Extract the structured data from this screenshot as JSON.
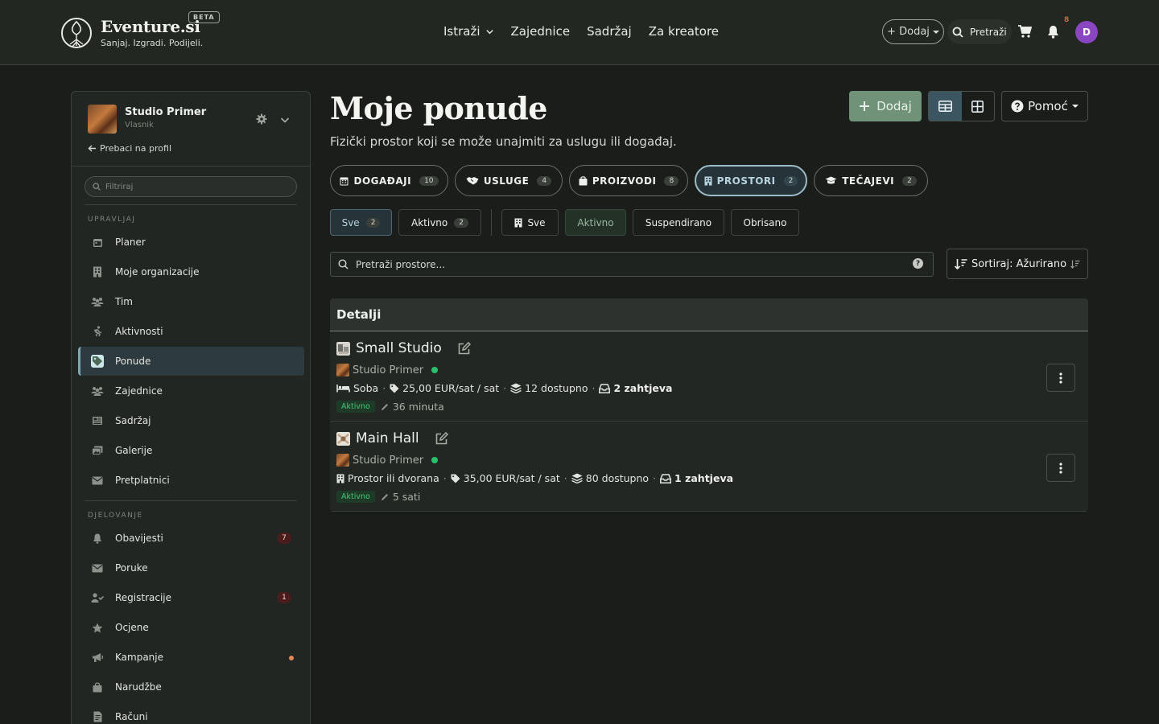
{
  "header": {
    "brand": "Eventure.si",
    "beta": "BETA",
    "tagline": "Sanjaj. Izgradi. Podijeli.",
    "nav": [
      "Istraži",
      "Zajednice",
      "Sadržaj",
      "Za kreatore"
    ],
    "add_label": "+ Dodaj",
    "search_label": "Pretraži",
    "notification_count": "8",
    "avatar_initial": "D"
  },
  "sidebar": {
    "org_name": "Studio Primer",
    "org_role": "Vlasnik",
    "switch_label": "Prebaci na profil",
    "filter_placeholder": "Filtriraj",
    "section_manage": "UPRAVLJAJ",
    "section_act": "DJELOVANJE",
    "manage_items": [
      {
        "label": "Planer",
        "icon": "calendar-icon"
      },
      {
        "label": "Moje organizacije",
        "icon": "building-icon"
      },
      {
        "label": "Tim",
        "icon": "team-icon"
      },
      {
        "label": "Aktivnosti",
        "icon": "running-icon"
      },
      {
        "label": "Ponude",
        "icon": "tag-icon"
      },
      {
        "label": "Zajednice",
        "icon": "community-icon"
      },
      {
        "label": "Sadržaj",
        "icon": "newspaper-icon"
      },
      {
        "label": "Galerije",
        "icon": "images-icon"
      },
      {
        "label": "Pretplatnici",
        "icon": "envelope-icon"
      }
    ],
    "act_items": [
      {
        "label": "Obavijesti",
        "icon": "bell-icon",
        "badge": "7"
      },
      {
        "label": "Poruke",
        "icon": "envelope-icon"
      },
      {
        "label": "Registracije",
        "icon": "user-check-icon",
        "badge": "1"
      },
      {
        "label": "Ocjene",
        "icon": "star-icon"
      },
      {
        "label": "Kampanje",
        "icon": "megaphone-icon"
      },
      {
        "label": "Narudžbe",
        "icon": "bag-icon"
      },
      {
        "label": "Računi",
        "icon": "invoice-icon"
      }
    ]
  },
  "main": {
    "title": "Moje ponude",
    "subtitle": "Fizički prostor koji se može unajmiti za uslugu ili događaj.",
    "add_label": "Dodaj",
    "help_label": "Pomoć",
    "types": [
      {
        "label": "DOGAĐAJI",
        "count": "10"
      },
      {
        "label": "USLUGE",
        "count": "4"
      },
      {
        "label": "PROIZVODI",
        "count": "8"
      },
      {
        "label": "PROSTORI",
        "count": "2"
      },
      {
        "label": "TEČAJEVI",
        "count": "2"
      }
    ],
    "filters_left": [
      {
        "label": "Sve",
        "count": "2"
      },
      {
        "label": "Aktivno",
        "count": "2"
      }
    ],
    "filters_right": [
      "Sve",
      "Aktivno",
      "Suspendirano",
      "Obrisano"
    ],
    "search_placeholder": "Pretraži prostore...",
    "sort_label": "Sortiraj: Ažurirano",
    "table_header": "Detalji",
    "rows": [
      {
        "title": "Small Studio",
        "org": "Studio Primer",
        "kind": "Soba",
        "price": "25,00 EUR/sat / sat",
        "available": "12 dostupno",
        "requests": "2 zahtjeva",
        "status": "Aktivno",
        "updated": "36 minuta"
      },
      {
        "title": "Main Hall",
        "org": "Studio Primer",
        "kind": "Prostor ili dvorana",
        "price": "35,00 EUR/sat / sat",
        "available": "80 dostupno",
        "requests": "1 zahtjeva",
        "status": "Aktivno",
        "updated": "5 sati"
      }
    ]
  }
}
